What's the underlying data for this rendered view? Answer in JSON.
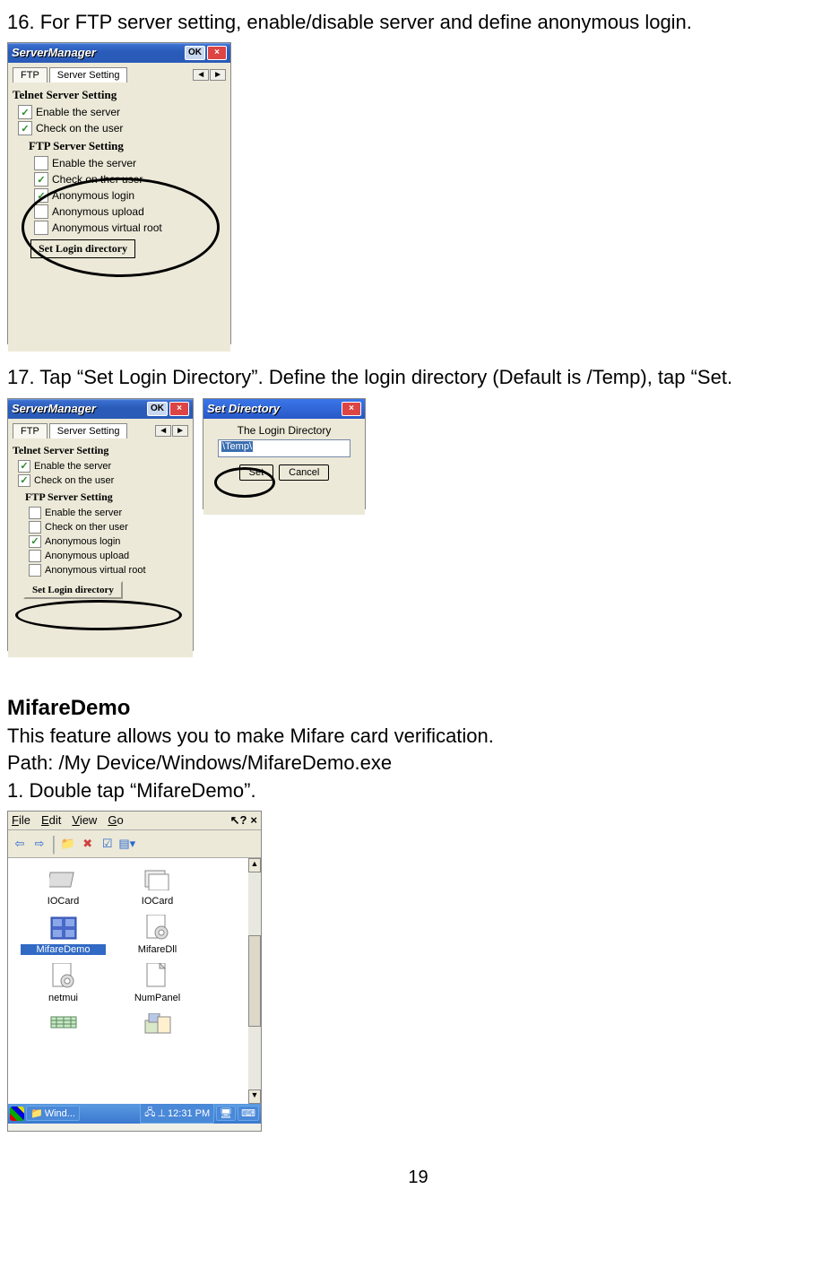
{
  "step16": {
    "text": "16. For FTP server setting, enable/disable server and define anonymous login."
  },
  "step17": {
    "text": "17. Tap “Set Login Directory”. Define the login directory (Default is /Temp), tap “Set."
  },
  "mifare": {
    "heading": "MifareDemo",
    "line1": "This feature allows you to make Mifare card verification.",
    "line2": "Path: /My Device/Windows/MifareDemo.exe",
    "step1": "1. Double tap “MifareDemo”."
  },
  "win1": {
    "title": "ServerManager",
    "ok": "OK",
    "tabs": {
      "ftp": "FTP",
      "server": "Server Setting"
    },
    "telnet_title": "Telnet Server Setting",
    "telnet_enable": "Enable the server",
    "telnet_check": "Check on the user",
    "ftp_title": "FTP Server Setting",
    "ftp_enable": "Enable the server",
    "ftp_check": "Check on ther user",
    "ftp_anon_login": "Anonymous login",
    "ftp_anon_upload": "Anonymous upload",
    "ftp_anon_vroot": "Anonymous virtual root",
    "set_login_btn": "Set Login directory"
  },
  "win2": {
    "title": "Set Directory",
    "label": "The Login Directory",
    "value": "\\Temp\\",
    "set": "Set",
    "cancel": "Cancel"
  },
  "explorer": {
    "menu": {
      "file": "File",
      "edit": "Edit",
      "view": "View",
      "go": "Go"
    },
    "icons": {
      "iocard1": "IOCard",
      "iocard2": "IOCard",
      "mifaredemo": "MifareDemo",
      "mifaredll": "MifareDll",
      "netmui": "netmui",
      "numpanel": "NumPanel"
    },
    "taskbar": {
      "wind": "Wind...",
      "time": "12:31 PM"
    }
  },
  "page_number": "19"
}
